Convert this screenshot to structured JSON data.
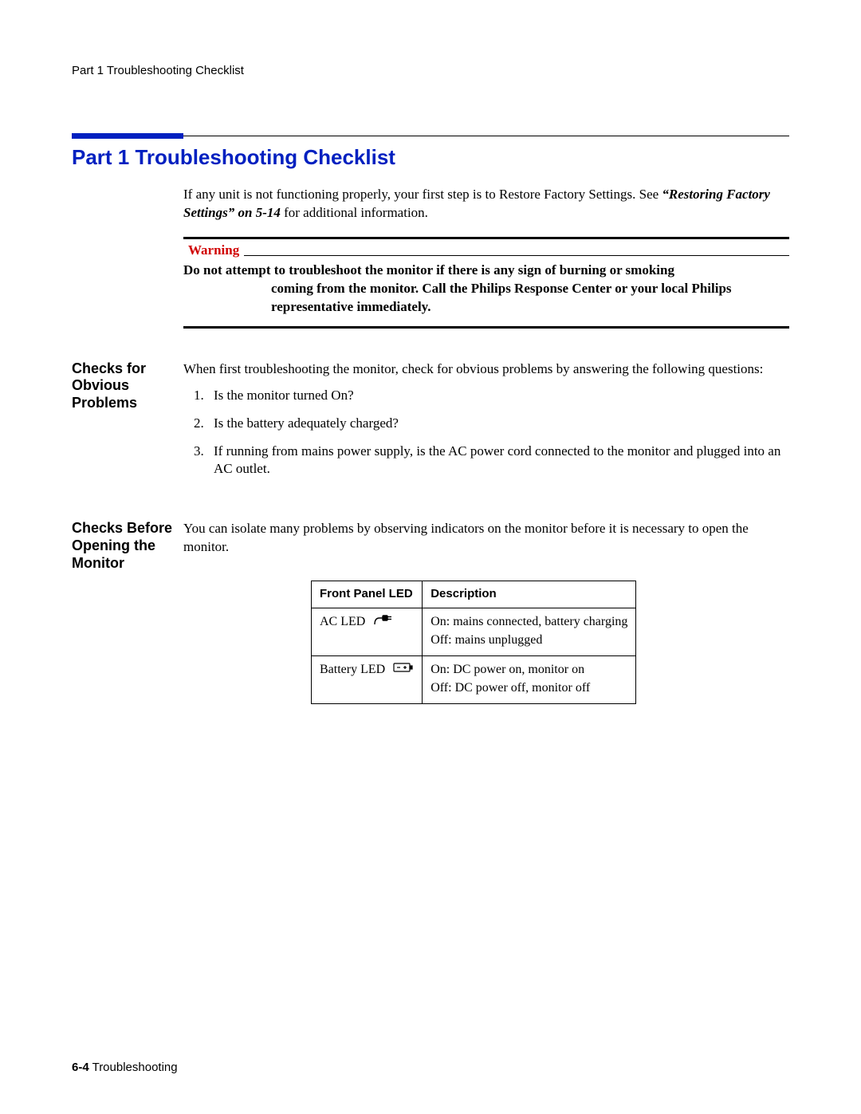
{
  "running_header": "Part 1 Troubleshooting Checklist",
  "title": "Part 1 Troubleshooting Checklist",
  "intro": {
    "line1": "If any unit is not functioning properly, your first step is to Restore Factory Settings. See ",
    "ref": "“Restoring Factory Settings” on 5-14",
    "line1_tail": " for additional information."
  },
  "warning": {
    "label": "Warning",
    "line1": "Do not attempt to troubleshoot the monitor if there is any sign of burning or smoking",
    "line2": "coming from the monitor. Call the Philips Response Center or your local Philips representative immediately."
  },
  "section1": {
    "heading": "Checks for Obvious Problems",
    "intro": "When first troubleshooting the monitor, check for obvious problems by answering the following questions:",
    "items": [
      "Is the monitor turned On?",
      "Is the battery adequately charged?",
      "If running from mains power supply, is the AC power cord connected to the monitor and plugged into an AC outlet."
    ]
  },
  "section2": {
    "heading": "Checks Before Opening the Monitor",
    "intro": "You can isolate many problems by observing indicators on the monitor before it is necessary to open the monitor."
  },
  "table": {
    "headers": [
      "Front Panel LED",
      "Description"
    ],
    "rows": [
      {
        "led": "AC LED",
        "icon": "plug-icon",
        "desc": [
          "On: mains connected, battery charging",
          "Off: mains unplugged"
        ]
      },
      {
        "led": "Battery LED",
        "icon": "battery-icon",
        "desc": [
          "On: DC power on, monitor on",
          "Off: DC power off, monitor off"
        ]
      }
    ]
  },
  "footer": {
    "pagenum": "6-4",
    "label": " Troubleshooting"
  }
}
